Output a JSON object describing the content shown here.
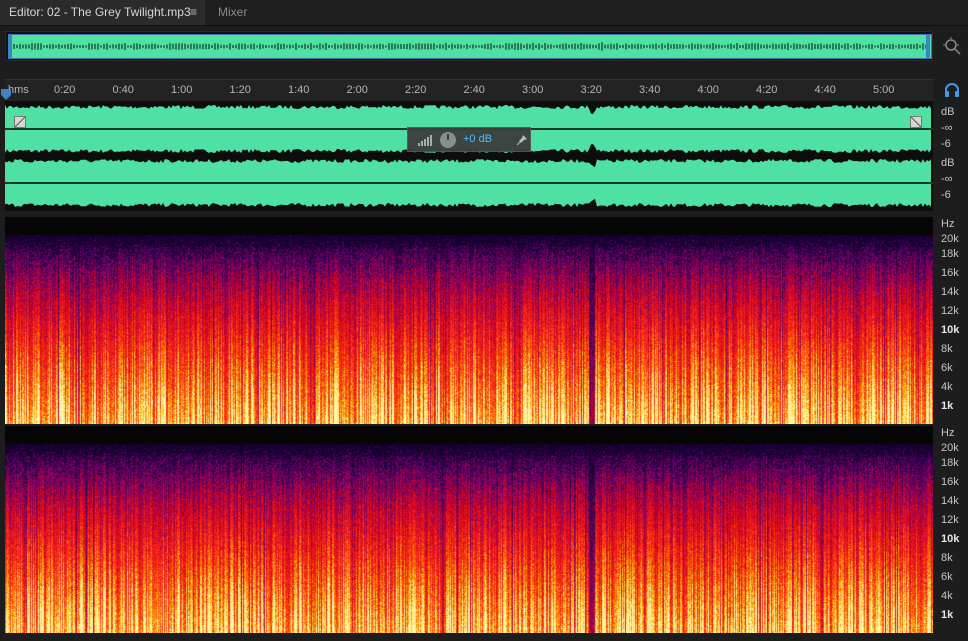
{
  "tabs": {
    "editor_label": "Editor: 02 - The Grey Twilight.mp3",
    "menu_glyph": "≡",
    "mixer_label": "Mixer"
  },
  "ruler": {
    "unit": "hms",
    "ticks": [
      "0:20",
      "0:40",
      "1:00",
      "1:20",
      "1:40",
      "2:00",
      "2:20",
      "2:40",
      "3:00",
      "3:20",
      "3:40",
      "4:00",
      "4:20",
      "4:40",
      "5:00"
    ]
  },
  "hud": {
    "volume": "+0 dB"
  },
  "amplitude_axis": {
    "unit": "dB",
    "labels": [
      "-∞",
      "-6"
    ]
  },
  "frequency_axis": {
    "unit": "Hz",
    "labels": [
      "20k",
      "18k",
      "16k",
      "14k",
      "12k",
      "10k",
      "8k",
      "6k",
      "4k",
      "1k"
    ]
  },
  "colors": {
    "waveform": "#4fe0a4",
    "accent": "#3f82c4",
    "hud_text": "#55b7ff"
  },
  "icons": [
    "menu-icon",
    "zoom-icon",
    "headphones-icon",
    "playhead-icon",
    "meter-icon",
    "volume-knob-icon",
    "pin-icon",
    "fade-in-handle-icon",
    "fade-out-handle-icon"
  ]
}
